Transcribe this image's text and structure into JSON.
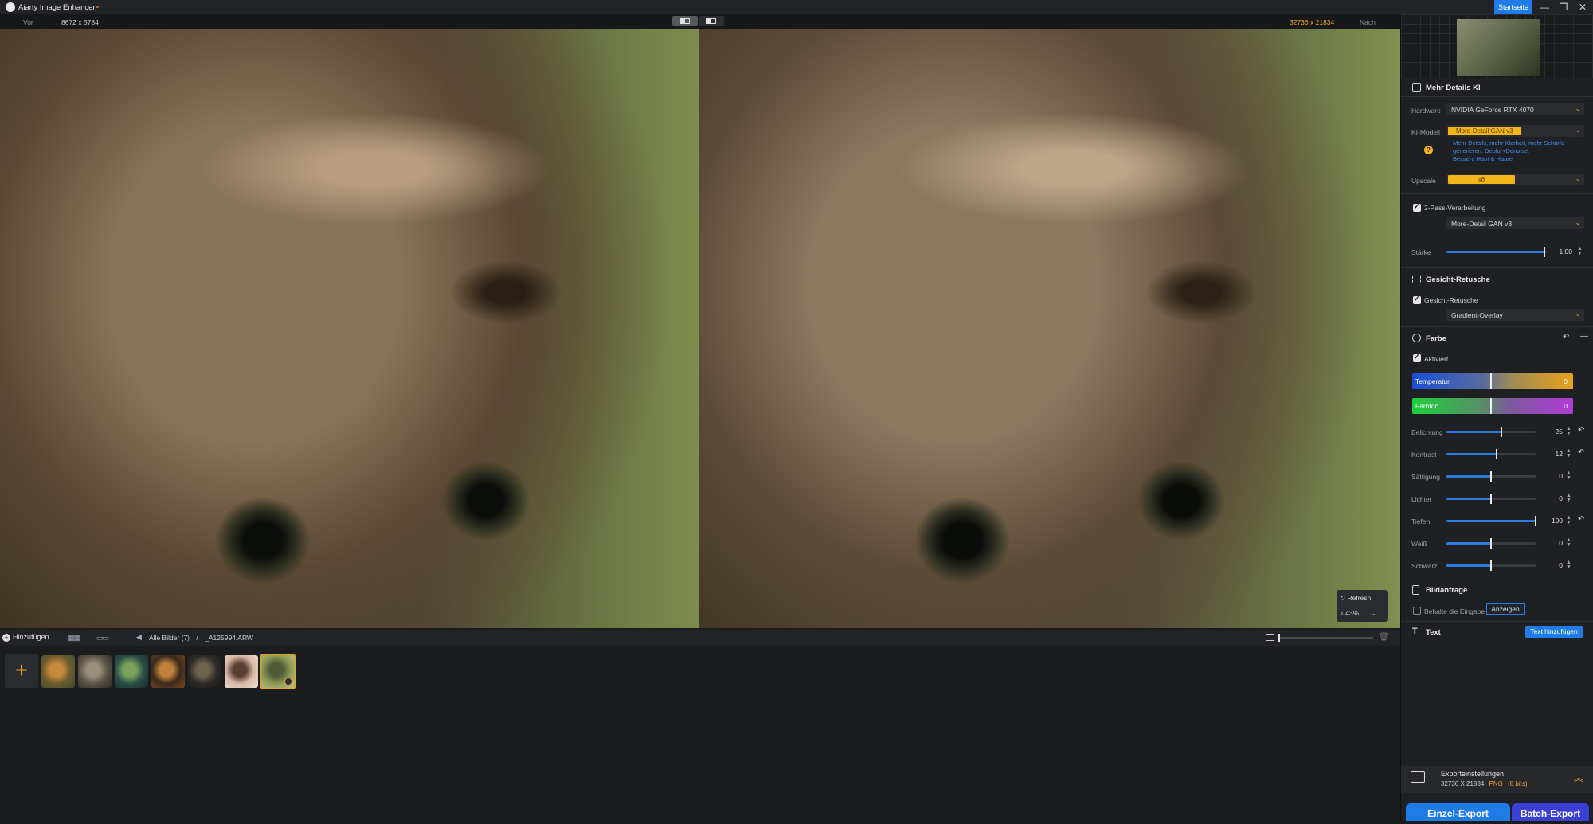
{
  "titlebar": {
    "app_name": "Aiarty Image Enhancer",
    "chevron": "⌄",
    "home_label": "Startseite",
    "minimize": "—",
    "maximize": "❐",
    "close": "✕"
  },
  "compare": {
    "before_label": "Vor",
    "before_dims": "8672 x 5784",
    "after_dims": "32736 x 21834",
    "after_label": "Nach"
  },
  "viewer": {
    "refresh_label": "Refresh",
    "zoom_value": "43%",
    "zoom_chevron": "⌄"
  },
  "bottombar": {
    "add_label": "Hinzufügen",
    "grid_icon": "grid-view-icon",
    "film_icon": "filmstrip-view-icon",
    "breadcrumb_all": "Alle Bilder (7)",
    "breadcrumb_sep": "/",
    "breadcrumb_file": "_A125994.ARW"
  },
  "filmstrip": {
    "add_tile": "+",
    "thumbnails": [
      {
        "name": "tiger",
        "colors": [
          "#6b5b2e",
          "#c78a3b",
          "#3d4b2a"
        ]
      },
      {
        "name": "owl",
        "colors": [
          "#5b5447",
          "#9a8f7c",
          "#2e2a24"
        ]
      },
      {
        "name": "lizard",
        "colors": [
          "#2b4f48",
          "#7aa25a",
          "#1a2a26"
        ]
      },
      {
        "name": "burger",
        "colors": [
          "#3a2a1b",
          "#c2813a",
          "#7a4a22"
        ]
      },
      {
        "name": "warrior",
        "colors": [
          "#2d2a27",
          "#6f624e",
          "#1a1816"
        ]
      },
      {
        "name": "portrait",
        "colors": [
          "#d9b9a6",
          "#5a3e33",
          "#efe0d6"
        ]
      },
      {
        "name": "monkey",
        "colors": [
          "#8b9a55",
          "#4f5a36",
          "#c8c18a"
        ]
      }
    ]
  },
  "panel": {
    "enhance": {
      "title": "Mehr Details KI",
      "hardware_label": "Hardware",
      "hardware_value": "NVIDIA GeForce RTX 4070",
      "model_label": "KI-Modell",
      "model_value": "More-Detail GAN  v3",
      "model_desc_1": "Mehr Details, mehr Klarheit, mehr Schärfe",
      "model_desc_2": "generieren. Deblur+Denoise.",
      "model_desc_3": "Bessere Haut & Haare",
      "upscale_label": "Upscale",
      "upscale_value": "x8",
      "twopass_label": "2-Pass-Verarbeitung",
      "twopass_model": "More-Detail GAN  v3",
      "strength_label": "Stärke",
      "strength_value": "1.00",
      "strength_level": 0.98
    },
    "face": {
      "title": "Gesicht-Retusche",
      "check_label": "Gesicht-Retusche",
      "mode_value": "Gradient-Overlay"
    },
    "color": {
      "title": "Farbe",
      "active_label": "Aktiviert",
      "temperature_label": "Temperatur",
      "temperature_value": "0",
      "tint_label": "Farbton",
      "tint_value": "0",
      "sliders": [
        {
          "label": "Belichtung",
          "value": "25",
          "level": 0.62,
          "reset": true
        },
        {
          "label": "Kontrast",
          "value": "12",
          "level": 0.56,
          "reset": true
        },
        {
          "label": "Sättigung",
          "value": "0",
          "level": 0.5,
          "reset": false
        },
        {
          "label": "Lichter",
          "value": "0",
          "level": 0.5,
          "reset": false
        },
        {
          "label": "Tiefen",
          "value": "100",
          "level": 1.0,
          "reset": true
        },
        {
          "label": "Weiß",
          "value": "0",
          "level": 0.5,
          "reset": false
        },
        {
          "label": "Schwarz",
          "value": "0",
          "level": 0.5,
          "reset": false
        }
      ]
    },
    "frame": {
      "title": "Bildanfrage",
      "keep_label": "Behalte die Eingabe",
      "show_button": "Anzeigen"
    },
    "text": {
      "title": "Text",
      "add_button": "Text hinzufügen"
    },
    "export": {
      "title": "Exporteinstellungen",
      "dims": "32736 X 21834",
      "format": "PNG",
      "bits": "(8 bits)",
      "single_label": "Einzel-Export",
      "batch_label": "Batch-Export"
    }
  },
  "colors": {
    "accent": "#1f7be8",
    "highlight": "#f0a42a",
    "chip": "#f4b51b",
    "slider": "#2f7be2"
  }
}
